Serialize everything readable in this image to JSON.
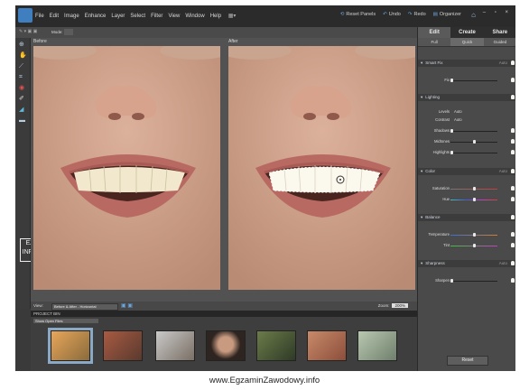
{
  "menu": [
    "File",
    "Edit",
    "Image",
    "Enhance",
    "Layer",
    "Select",
    "Filter",
    "View",
    "Window",
    "Help"
  ],
  "actions": {
    "reset_panels": "Reset Panels",
    "undo": "Undo",
    "redo": "Redo",
    "organizer": "Organizer"
  },
  "window_buttons": "– ▫ ×",
  "options": {
    "mode_label": "Mode:"
  },
  "canvas": {
    "before_label": "Before",
    "after_label": "After"
  },
  "viewbar": {
    "view_label": "View:",
    "view_value": "Before & After - Horizontal",
    "zoom_label": "Zoom:",
    "zoom_value": "200%"
  },
  "project_bin": {
    "title": "PROJECT BIN",
    "show_label": "Show Open Files"
  },
  "panel": {
    "tabs": [
      "Edit",
      "Create",
      "Share"
    ],
    "subtabs": [
      "Full",
      "Quick",
      "Guided"
    ],
    "sections": {
      "smart_fix": {
        "title": "Smart Fix",
        "auto": "Auto",
        "fix_label": "Fix"
      },
      "lighting": {
        "title": "Lighting",
        "levels_label": "Levels",
        "levels_btn": "Auto",
        "contrast_label": "Contrast",
        "contrast_btn": "Auto",
        "shadows": "Shadows",
        "midtones": "Midtones",
        "highlights": "Highlights"
      },
      "color": {
        "title": "Color",
        "auto": "Auto",
        "saturation": "Saturation",
        "hue": "Hue"
      },
      "balance": {
        "title": "Balance",
        "temperature": "Temperature",
        "tint": "Tint"
      },
      "sharpness": {
        "title": "Sharpness",
        "auto": "Auto",
        "sharpen": "Sharpen"
      }
    },
    "reset": "Reset"
  },
  "watermark": "EZ INFO",
  "caption": "www.EgzaminZawodowy.info"
}
